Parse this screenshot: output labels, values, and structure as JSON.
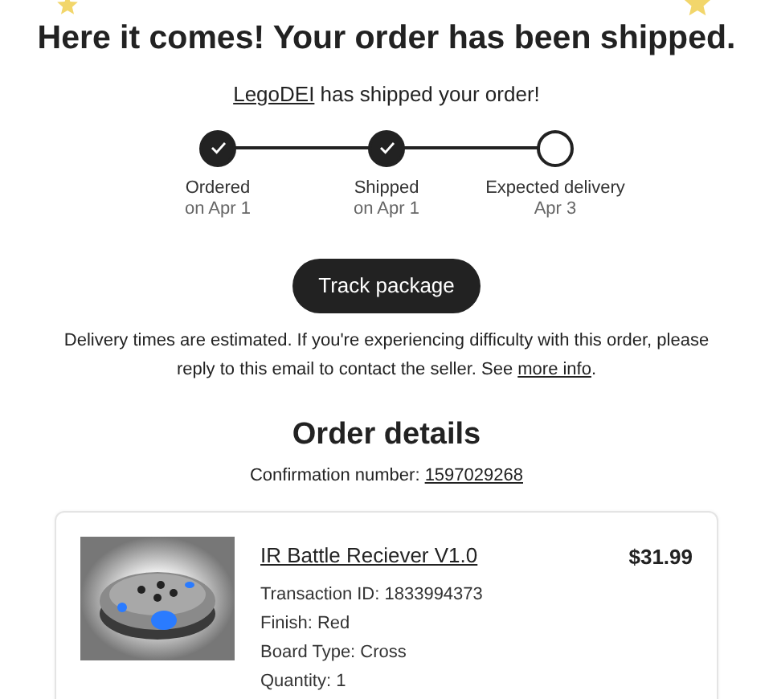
{
  "heading": "Here it comes! Your order has been shipped.",
  "seller_line": {
    "link": "LegoDEI",
    "text": " has shipped your order!"
  },
  "steps": [
    {
      "label": "Ordered",
      "date": "on Apr 1",
      "done": true
    },
    {
      "label": "Shipped",
      "date": "on Apr 1",
      "done": true
    },
    {
      "label": "Expected delivery",
      "date": "Apr 3",
      "done": false
    }
  ],
  "track_button": "Track package",
  "notice": {
    "text": "Delivery times are estimated. If you're experiencing difficulty with this order, please reply to this email to contact the seller. See ",
    "link": "more info",
    "end": "."
  },
  "order_details": {
    "title": "Order details",
    "confirmation_label": "Confirmation number: ",
    "confirmation_number": "1597029268"
  },
  "item": {
    "kind": "picture",
    "name": "IR Battle Reciever V1.0",
    "price": "$31.99",
    "lines": [
      "Transaction ID: 1833994373",
      "Finish: Red",
      "Board Type: Cross",
      "Quantity: 1"
    ]
  }
}
